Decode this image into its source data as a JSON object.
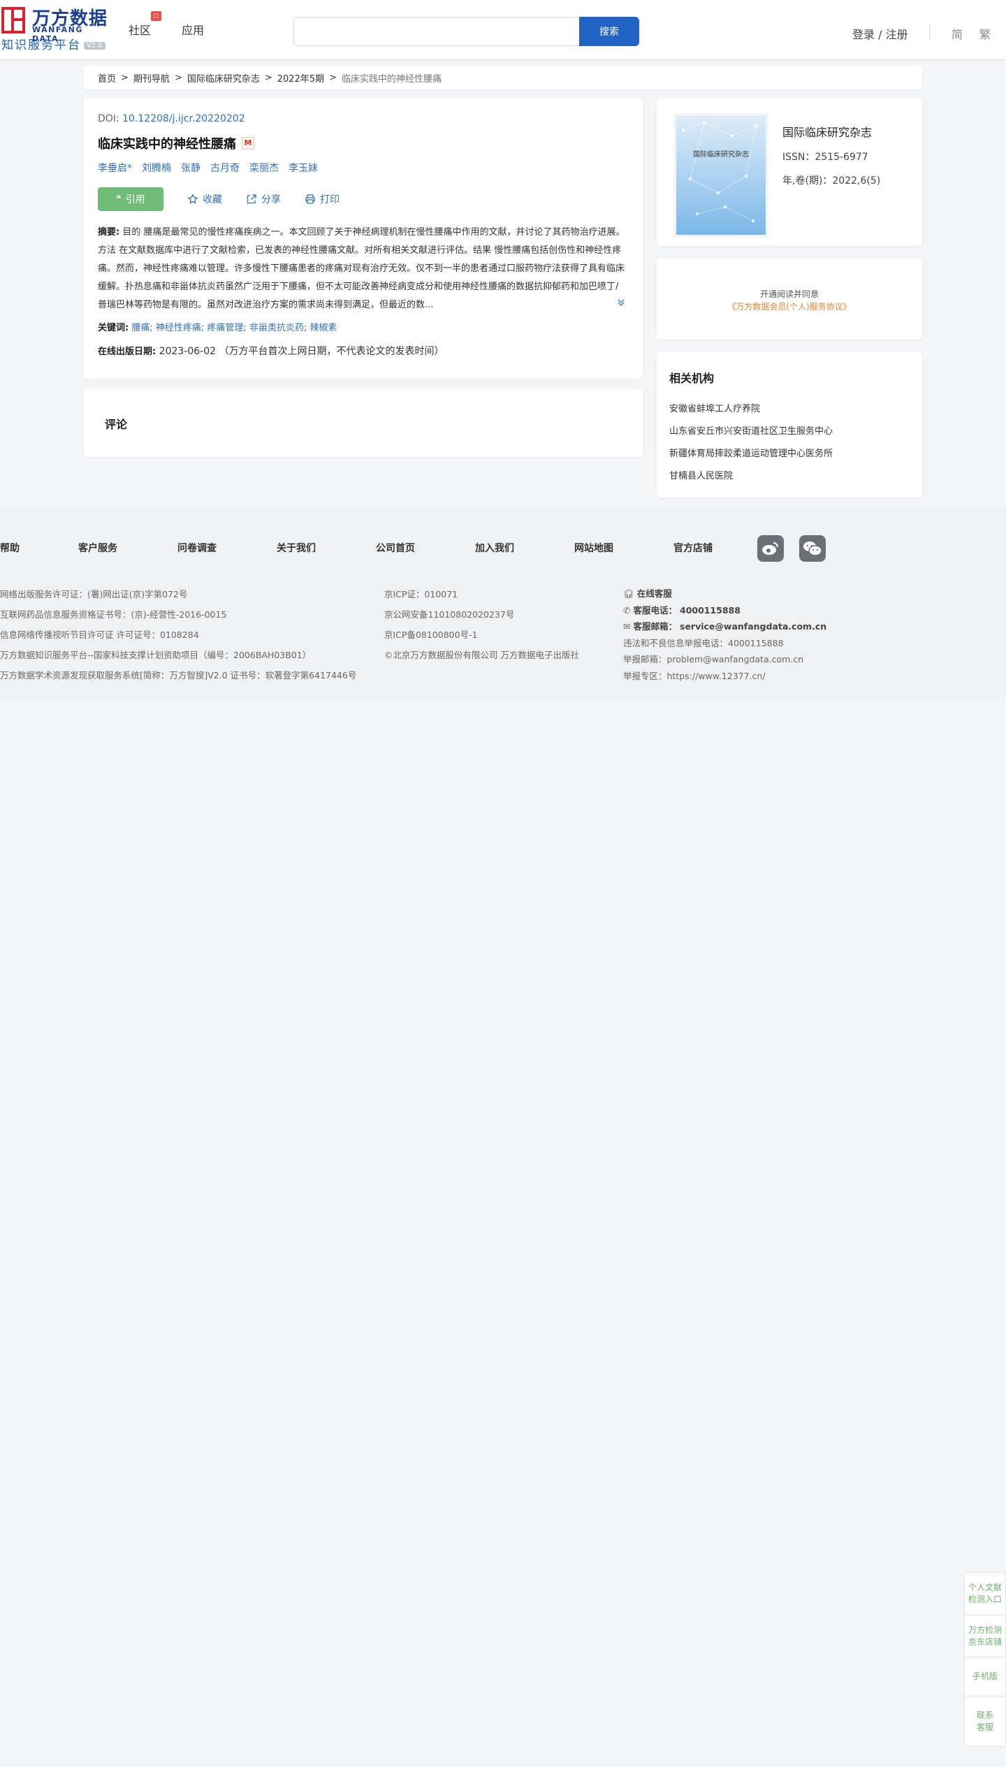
{
  "header": {
    "logo_cn": "万方数据",
    "logo_en": "WANFANG DATA",
    "logo_sub": "知识服务平台",
    "logo_version": "V2.0",
    "nav": [
      "社区",
      "应用"
    ],
    "search_placeholder": "",
    "search_button": "搜索",
    "login": "登录 / 注册",
    "lang_simplified": "简",
    "lang_traditional": "繁"
  },
  "breadcrumb": {
    "items": [
      "首页",
      "期刊导航",
      "国际临床研究杂志",
      "2022年5期"
    ],
    "current": "临床实践中的神经性腰痛"
  },
  "article": {
    "doi_label": "DOI:",
    "doi": "10.12208/j.ijcr.20220202",
    "title": "临床实践中的神经性腰痛",
    "title_badge": "M",
    "authors": [
      "李垂启*",
      "刘腾楠",
      "张静",
      "古月奇",
      "栾丽杰",
      "李玉妹"
    ],
    "actions": {
      "cite": "引用",
      "favorite": "收藏",
      "share": "分享",
      "print": "打印"
    },
    "abstract_label": "摘要:",
    "abstract": "目的 腰痛是最常见的慢性疼痛疾病之一。本文回顾了关于神经病理机制在慢性腰痛中作用的文献，并讨论了其药物治疗进展。方法 在文献数据库中进行了文献检索，已发表的神经性腰痛文献。对所有相关文献进行评估。结果 慢性腰痛包括创伤性和神经性疼痛。然而，神经性疼痛难以管理。许多慢性下腰痛患者的疼痛对现有治疗无效。仅不到一半的患者通过口服药物疗法获得了具有临床缓解。扑热息痛和非甾体抗炎药虽然广泛用于下腰痛，但不太可能改善神经病变成分和使用神经性腰痛的数据抗抑郁药和加巴喷丁/普瑞巴林等药物是有限的。虽然对改进治疗方案的需求尚未得到满足，但最近的数...",
    "keywords_label": "关键词:",
    "keywords": [
      "腰痛;",
      "神经性疼痛;",
      "疼痛管理;",
      "非甾类抗炎药;",
      "辣椒素"
    ],
    "pubdate_label": "在线出版日期:",
    "pubdate": "2023-06-02",
    "pubdate_note": "（万方平台首次上网日期，不代表论文的发表时间）"
  },
  "comment": {
    "title": "评论"
  },
  "journal": {
    "cover_title": "国际临床研究杂志",
    "name": "国际临床研究杂志",
    "issn": "ISSN：2515-6977",
    "volume": "年,卷(期)：2022,6(5)"
  },
  "notice": {
    "line1": "开通阅读并同意",
    "line2": "《万方数据会员(个人)服务协议》"
  },
  "orgs": {
    "title": "相关机构",
    "items": [
      "安徽省蚌埠工人疗养院",
      "山东省安丘市兴安街道社区卫生服务中心",
      "新疆体育局摔跤柔道运动管理中心医务所",
      "甘楠县人民医院"
    ]
  },
  "footer": {
    "nav": [
      "帮助",
      "客户服务",
      "问卷调查",
      "关于我们",
      "公司首页",
      "加入我们",
      "网站地图",
      "官方店铺"
    ],
    "col1": [
      "网络出版服务许可证：(署)网出证(京)字第072号",
      "互联网药品信息服务资格证书号：(京)-经营性-2016-0015",
      "信息网络传播视听节目许可证 许可证号：0108284",
      "万方数据知识服务平台--国家科技支撑计划资助项目（编号：2006BAH03B01）",
      "万方数据学术资源发现获取服务系统[简称：万方智搜]V2.0 证书号：软著登字第6417446号"
    ],
    "col2": [
      "京ICP证：010071",
      "京公网安备11010802020237号",
      "京ICP备08100800号-1",
      "©北京万方数据股份有限公司 万方数据电子出版社"
    ],
    "service_label": "在线客服",
    "phone_label": "客服电话：",
    "phone": "4000115888",
    "email_label": "客服邮箱：",
    "email": "service@wanfangdata.com.cn",
    "report_phone": "违法和不良信息举报电话：4000115888",
    "report_email": "举报邮箱：problem@wanfangdata.com.cn",
    "report_zone": "举报专区：https://www.12377.cn/"
  },
  "float_bar": {
    "btn1": "个人文献检测入口",
    "btn2": "万方检测京东店铺",
    "btn3": "手机版",
    "btn4": "联系客服"
  }
}
